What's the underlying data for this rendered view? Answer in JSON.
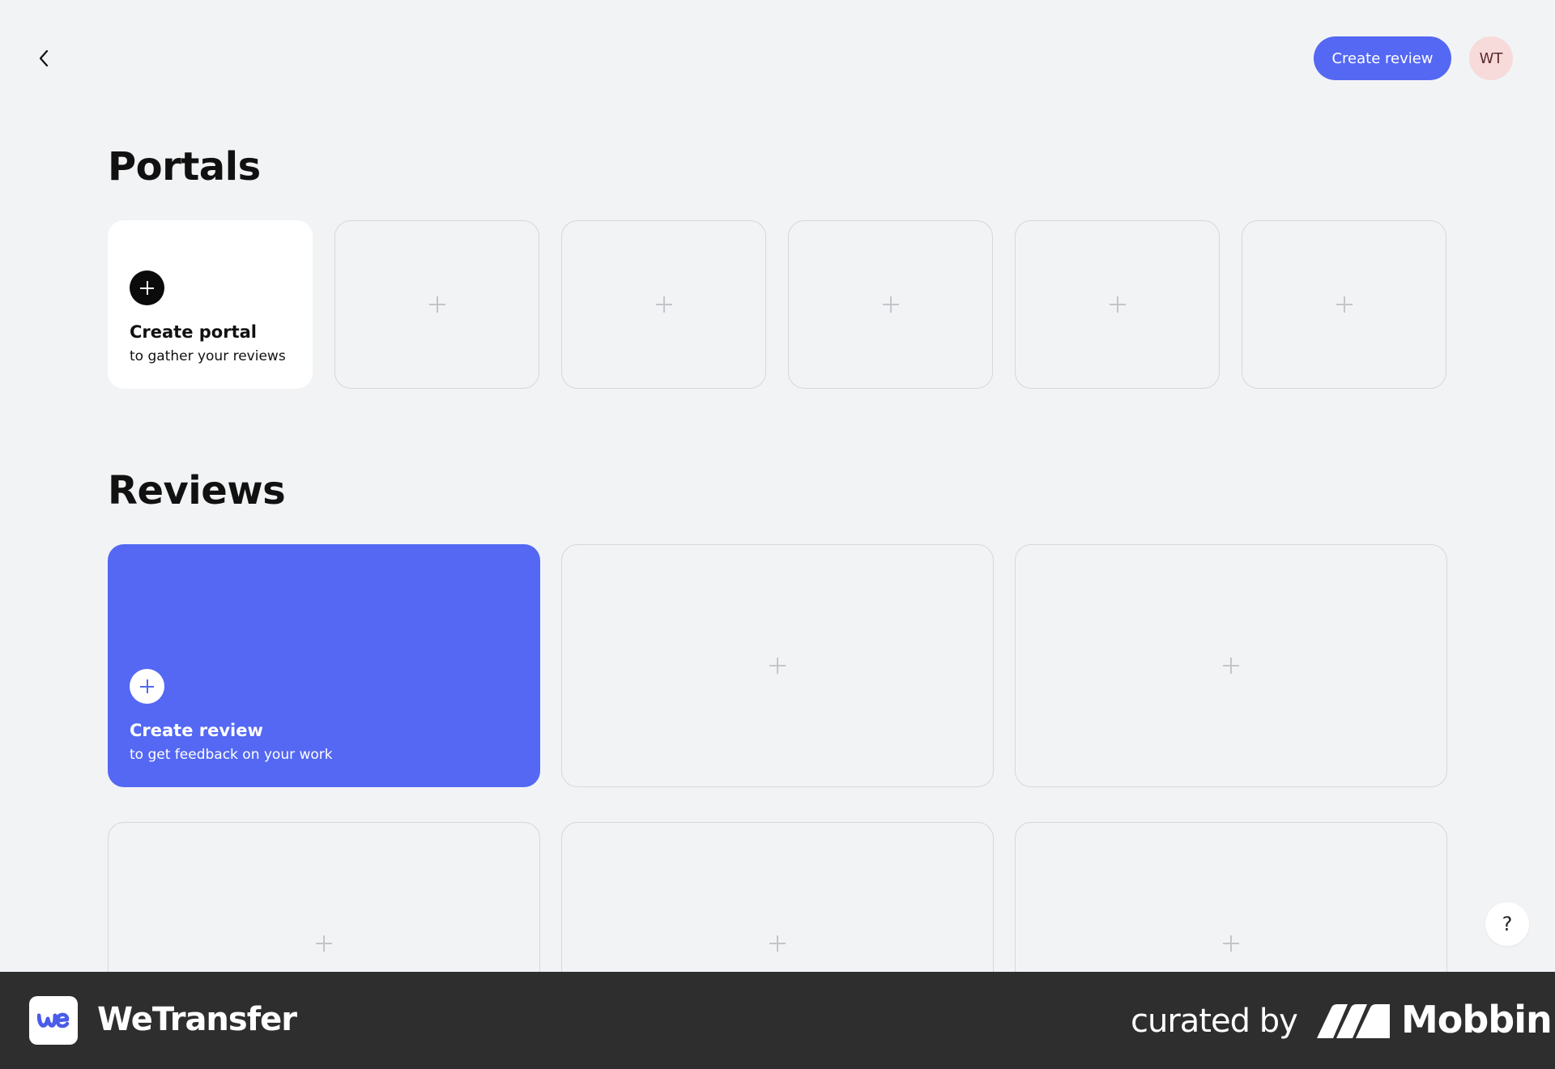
{
  "header": {
    "back_icon": "chevron-left-icon",
    "create_review_label": "Create review",
    "avatar_initials": "WT"
  },
  "portals": {
    "title": "Portals",
    "create_card": {
      "title": "Create portal",
      "subtitle": "to gather your reviews"
    },
    "placeholder_count": 5
  },
  "reviews": {
    "title": "Reviews",
    "create_card": {
      "title": "Create review",
      "subtitle": "to get feedback on your work"
    },
    "placeholder_count": 5
  },
  "help_label": "?",
  "footer": {
    "brand": "WeTransfer",
    "curated_label": "curated by",
    "curator": "Mobbin"
  },
  "colors": {
    "accent": "#5468f3",
    "background": "#f2f3f5",
    "avatar_bg": "#f7dada",
    "footer_bg": "#2e2e2e"
  }
}
